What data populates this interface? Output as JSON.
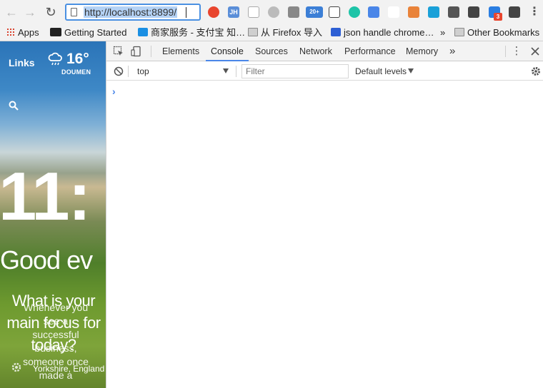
{
  "browser": {
    "back_glyph": "←",
    "forward_glyph": "→",
    "reload_glyph": "↻",
    "url": "http://localhost:8899/",
    "extension_badges": {
      "jh": "JH",
      "count": "20+",
      "red_badge": "3"
    }
  },
  "bookmarks": {
    "apps": "Apps",
    "getting_started": "Getting Started",
    "shangjia": "商家服务 - 支付宝 知…",
    "firefox": "从 Firefox 导入",
    "json_handle": "json handle chrome…",
    "overflow": "»",
    "other": "Other Bookmarks"
  },
  "page": {
    "links": "Links",
    "temperature": "16°",
    "location": "DOUMEN",
    "clock": "11:",
    "greeting": "Good ev",
    "focus_question": "What is your main focus for today?",
    "quote": "Whenever you see a successful business, someone once made a",
    "photo_location": "Yorkshire, England"
  },
  "devtools": {
    "tabs": [
      "Elements",
      "Console",
      "Sources",
      "Network",
      "Performance",
      "Memory"
    ],
    "active_tab": "Console",
    "more_tabs": "»",
    "context": "top",
    "filter_placeholder": "Filter",
    "levels": "Default levels",
    "prompt": "›"
  },
  "colors": {
    "accent": "#4a86e8",
    "url_highlight": "#b4d2f5"
  }
}
